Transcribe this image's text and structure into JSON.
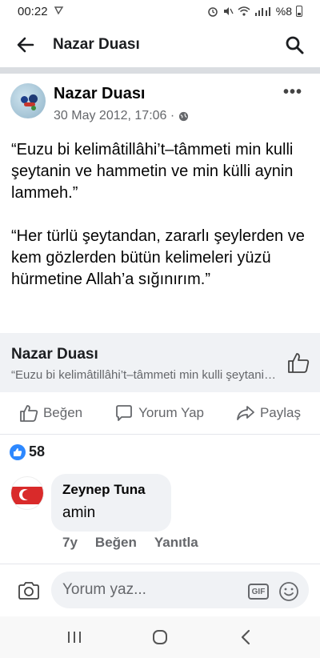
{
  "status_bar": {
    "time": "00:22",
    "battery": "%8"
  },
  "app_bar": {
    "title": "Nazar Duası",
    "back_icon": "arrow-left-icon",
    "search_icon": "search-icon"
  },
  "post": {
    "author": "Nazar Duası",
    "timestamp": "30 May 2012, 17:06 ·",
    "privacy_icon": "globe-icon",
    "more_icon": "more-icon",
    "more_text": "•••",
    "paragraphs": [
      "“Euzu bi kelimâtillâhi’t–tâmmeti min kulli şeytanin ve hammetin ve min külli aynin lammeh.”",
      "“Her türlü şeytandan, zararlı şeylerden ve kem gözlerden bütün kelimeleri yüzü hürmetine Allah’a sığınırım.”"
    ]
  },
  "link_card": {
    "title": "Nazar Duası",
    "subtitle": "“Euzu bi kelimâtillâhi’t–tâmmeti min kulli şeytanin ve hammetin ve min külli aynin lammeh.”"
  },
  "actions": {
    "like": "Beğen",
    "comment": "Yorum Yap",
    "share": "Paylaş"
  },
  "reactions": {
    "count": "58"
  },
  "comment": {
    "author": "Zeynep Tuna",
    "text": "amin",
    "time": "7y",
    "like": "Beğen",
    "reply": "Yanıtla"
  },
  "composer": {
    "placeholder": "Yorum yaz...",
    "gif": "GIF"
  },
  "colors": {
    "accent": "#2d88ff",
    "secondary_text": "#65676b",
    "card_background": "#f0f2f5"
  }
}
